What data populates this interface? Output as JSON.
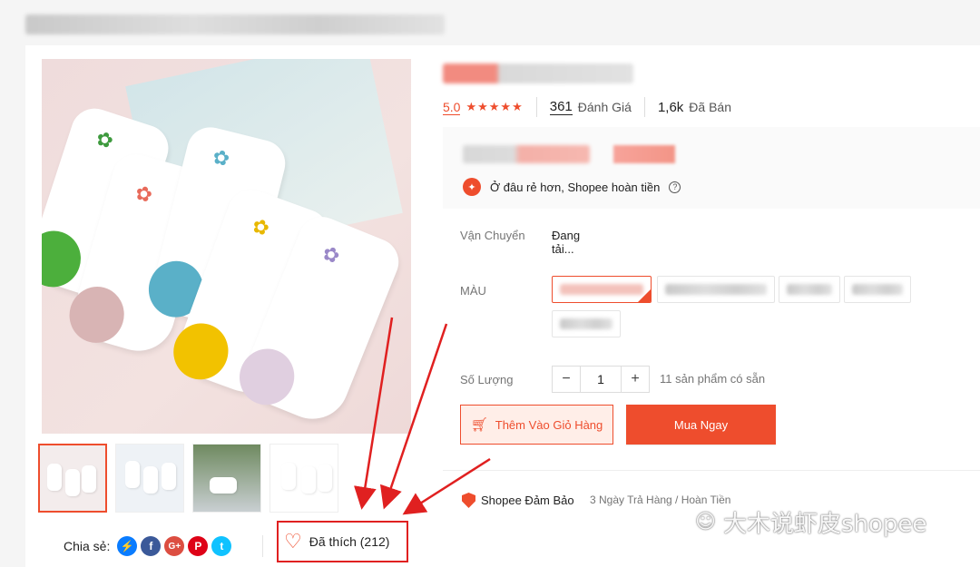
{
  "rating": {
    "score": "5.0",
    "stars": "★★★★★",
    "reviews_count": "361",
    "reviews_label": "Đánh Giá",
    "sold_count": "1,6k",
    "sold_label": "Đã Bán"
  },
  "price": {
    "guarantee_text": "Ở đâu rẻ hơn, Shopee hoàn tiền",
    "help_glyph": "?"
  },
  "shipping": {
    "label": "Vận Chuyển",
    "value": "Đang tải..."
  },
  "variant": {
    "label": "MÀU"
  },
  "quantity": {
    "label": "Số Lượng",
    "value": "1",
    "minus": "−",
    "plus": "+",
    "stock_text": "11 sản phẩm có sẵn"
  },
  "actions": {
    "add_to_cart": "Thêm Vào Giỏ Hàng",
    "buy_now": "Mua Ngay"
  },
  "assurance": {
    "title": "Shopee Đảm Bảo",
    "subtitle": "3 Ngày Trả Hàng / Hoàn Tiền"
  },
  "share": {
    "label": "Chia sẻ:",
    "icons": [
      "messenger-icon",
      "facebook-icon",
      "google-plus-icon",
      "pinterest-icon",
      "twitter-icon"
    ]
  },
  "like": {
    "text": "Đã thích (212)"
  },
  "watermark": {
    "text": "大木说虾皮shopee"
  },
  "colors": {
    "accent": "#ee4d2d",
    "annotation": "#e02020"
  }
}
